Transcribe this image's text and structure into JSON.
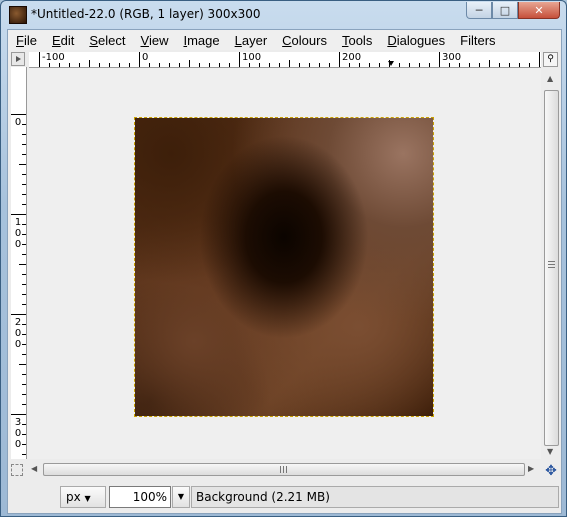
{
  "window": {
    "title": "*Untitled-22.0 (RGB, 1 layer) 300x300",
    "icons": [
      "gimp-image-icon",
      "minimize-icon",
      "maximize-icon",
      "close-icon"
    ]
  },
  "menubar": {
    "items": [
      {
        "mnemonic": "F",
        "rest": "ile"
      },
      {
        "mnemonic": "E",
        "rest": "dit"
      },
      {
        "mnemonic": "S",
        "rest": "elect"
      },
      {
        "mnemonic": "V",
        "rest": "iew"
      },
      {
        "mnemonic": "I",
        "rest": "mage"
      },
      {
        "mnemonic": "L",
        "rest": "ayer"
      },
      {
        "mnemonic": "C",
        "rest": "olours"
      },
      {
        "mnemonic": "T",
        "rest": "ools"
      },
      {
        "mnemonic": "D",
        "rest": "ialogues"
      },
      {
        "mnemonic": "",
        "rest": "Filters"
      }
    ]
  },
  "hruler": {
    "labels": [
      "-100",
      "0",
      "100",
      "200",
      "300"
    ]
  },
  "vruler": {
    "labels": [
      [
        "0"
      ],
      [
        "1",
        "0",
        "0"
      ],
      [
        "2",
        "0",
        "0"
      ],
      [
        "3",
        "0",
        "0"
      ]
    ]
  },
  "statusbar": {
    "unit": "px",
    "zoom": "100%",
    "message": "Background (2.21 MB)"
  },
  "colors": {
    "selection_outline": "#c8a000",
    "canvas_bg": "#efefef"
  }
}
